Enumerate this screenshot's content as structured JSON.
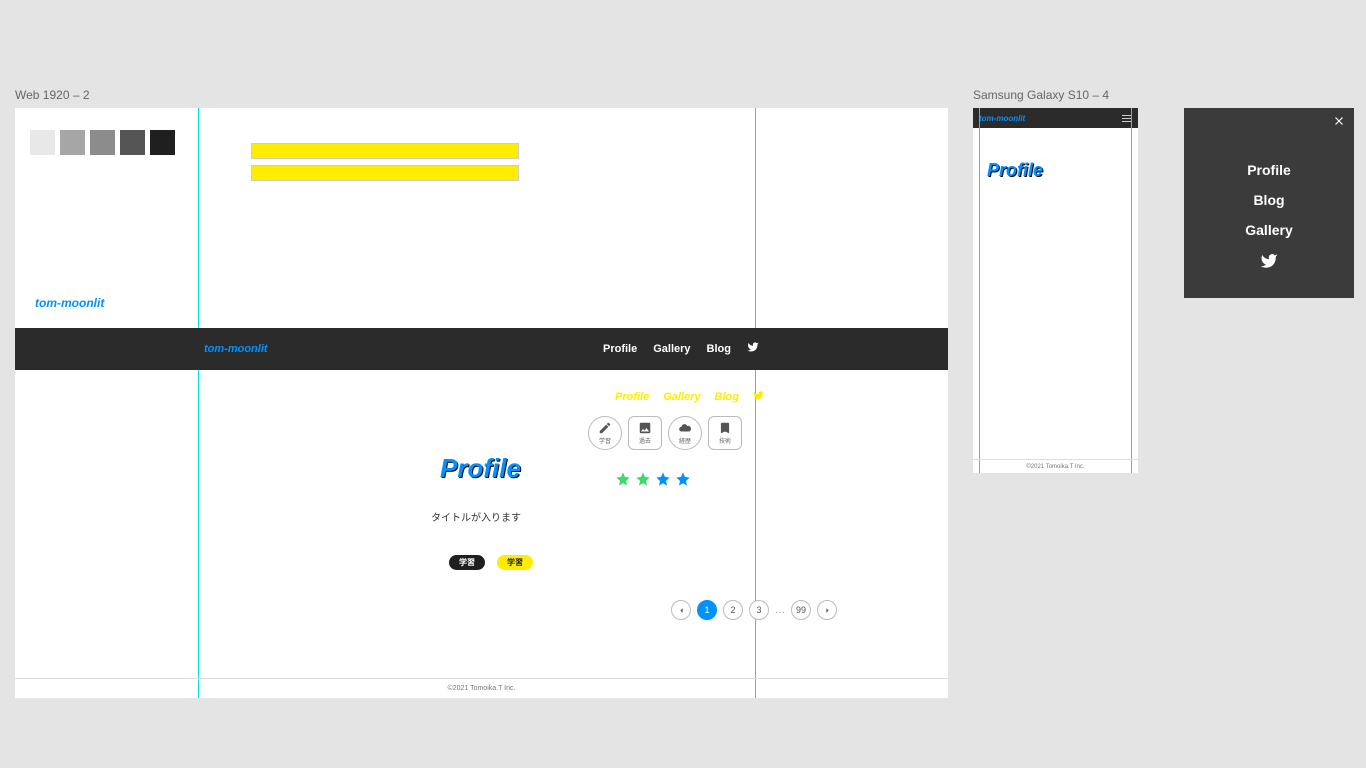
{
  "artboards": {
    "web": {
      "label": "Web 1920 – 2"
    },
    "mobile": {
      "label": "Samsung Galaxy S10 – 4"
    }
  },
  "brand": "tom-moonlit",
  "nav": {
    "profile": "Profile",
    "gallery": "Gallery",
    "blog": "Blog"
  },
  "headings": {
    "profile": "Profile"
  },
  "subtitle": "タイトルが入ります",
  "tags": {
    "dark": "学習",
    "yellow": "学習"
  },
  "icon_chips": {
    "a": "学習",
    "b": "過去",
    "c": "経歴",
    "d": "技術"
  },
  "pager": {
    "p1": "1",
    "p2": "2",
    "p3": "3",
    "dots": "…",
    "last": "99"
  },
  "footer": "©2021 Tomoika.T Inc.",
  "colors": {
    "swatches": [
      "#e8e8e8",
      "#a6a6a6",
      "#8c8c8c",
      "#555555",
      "#1f1f1f"
    ],
    "accent": "#0091ff",
    "highlight": "#ffed00",
    "stars": [
      "#3fd96b",
      "#3fd96b",
      "#0091ff",
      "#0091ff"
    ]
  }
}
